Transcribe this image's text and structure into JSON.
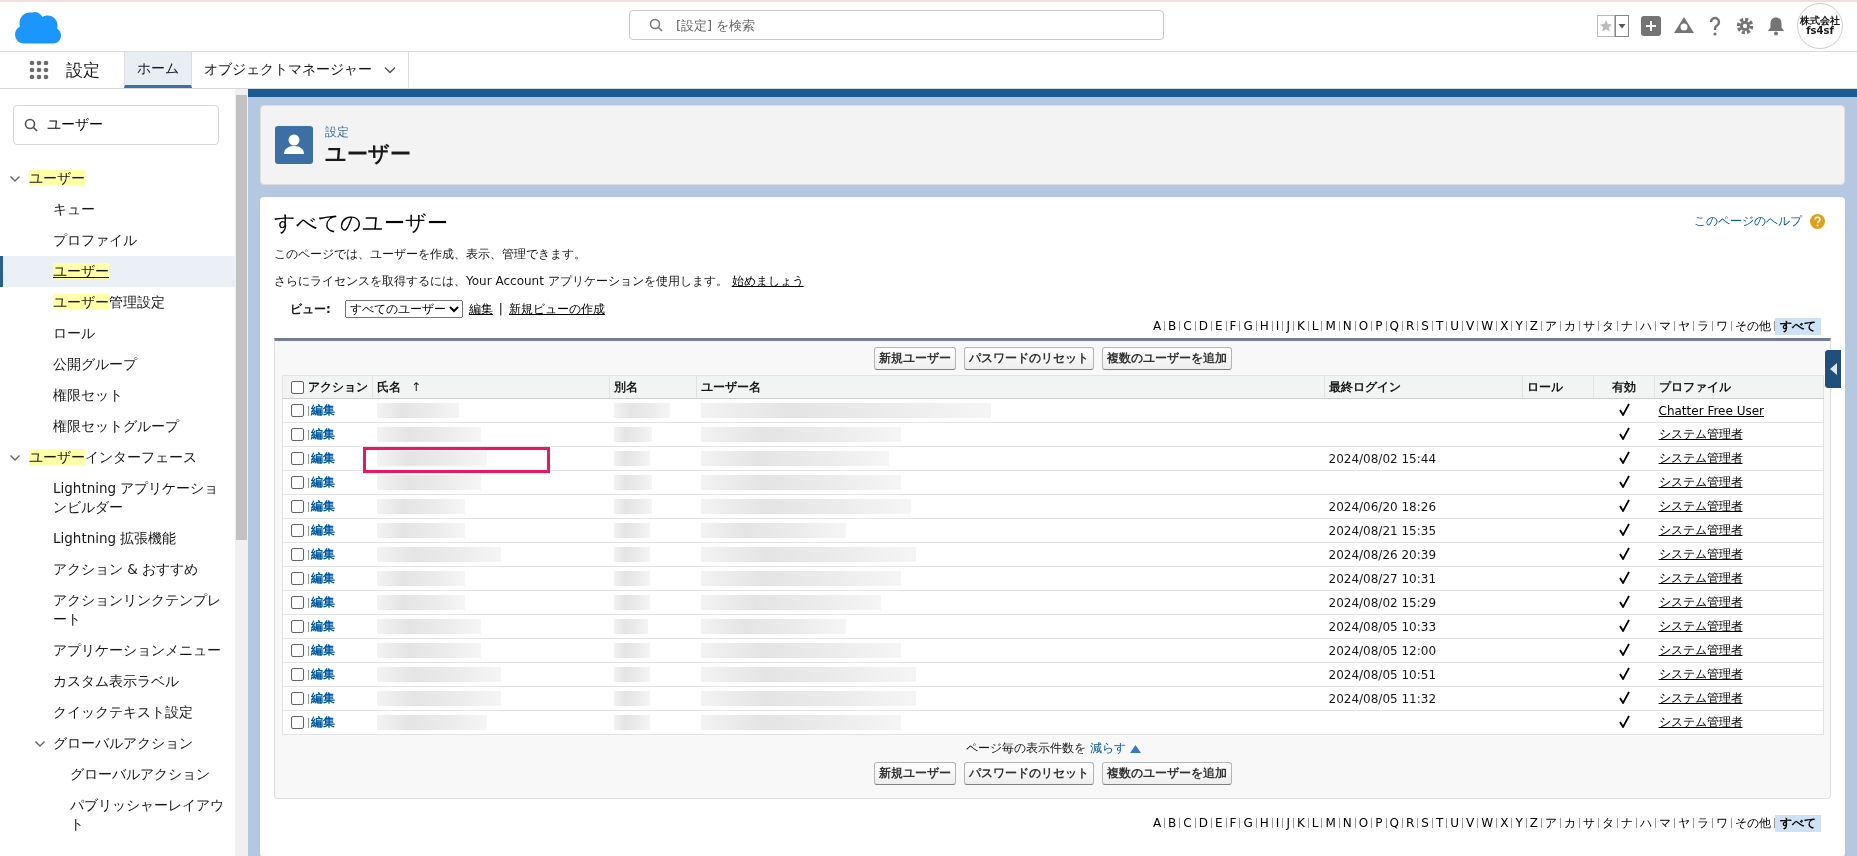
{
  "global_header": {
    "search": {
      "placeholder": "[設定] を検索"
    },
    "avatar": {
      "line1": "株式会社",
      "line2": "fs4sf"
    }
  },
  "app_nav": {
    "app_name": "設定",
    "tabs": [
      {
        "label": "ホーム",
        "selected": true,
        "dropdown": false
      },
      {
        "label": "オブジェクトマネージャー",
        "selected": false,
        "dropdown": true
      }
    ]
  },
  "sidebar": {
    "search": {
      "value": "ユーザー"
    },
    "items": [
      {
        "match": "ユーザー",
        "expanded": true,
        "selected": false,
        "children": [
          {
            "rest": "キュー",
            "selected": false
          },
          {
            "rest": "プロファイル",
            "selected": false
          },
          {
            "match": "ユーザー",
            "selected": true
          },
          {
            "match": "ユーザー",
            "rest": "管理設定",
            "selected": false
          },
          {
            "rest": "ロール",
            "selected": false
          },
          {
            "rest": "公開グループ",
            "selected": false
          },
          {
            "rest": "権限セット",
            "selected": false
          },
          {
            "rest": "権限セットグループ",
            "selected": false
          }
        ]
      },
      {
        "match": "ユーザー",
        "rest": "インターフェース",
        "expanded": true,
        "selected": false,
        "children": [
          {
            "rest": "Lightning アプリケーションビルダー",
            "selected": false
          },
          {
            "rest": "Lightning 拡張機能",
            "selected": false
          },
          {
            "rest": "アクション & おすすめ",
            "selected": false
          },
          {
            "rest": "アクションリンクテンプレート",
            "selected": false
          },
          {
            "rest": "アプリケーションメニュー",
            "selected": false
          },
          {
            "rest": "カスタム表示ラベル",
            "selected": false
          },
          {
            "rest": "クイックテキスト設定",
            "selected": false
          },
          {
            "rest": "グローバルアクション",
            "expanded": true,
            "selected": false,
            "children": [
              {
                "rest": "グローバルアクション",
                "selected": false
              },
              {
                "rest": "パブリッシャーレイアウト",
                "selected": false
              }
            ]
          }
        ]
      }
    ]
  },
  "page_header": {
    "breadcrumb": "設定",
    "title": "ユーザー"
  },
  "main": {
    "title": "すべてのユーザー",
    "help_link": "このページのヘルプ",
    "description": "このページでは、ユーザーを作成、表示、管理できます。",
    "license_text": "さらにライセンスを取得するには、Your Account アプリケーションを使用します。",
    "license_link": "始めましょう",
    "view": {
      "label": "ビュー:",
      "selected_view": "すべてのユーザー",
      "edit_link": "編集",
      "separator": "|",
      "new_view_link": "新規ビューの作成"
    },
    "alpha_top": [
      {
        "label": "A",
        "selected": false
      },
      {
        "label": "B",
        "selected": false
      },
      {
        "label": "C",
        "selected": false
      },
      {
        "label": "D",
        "selected": false
      },
      {
        "label": "E",
        "selected": false
      },
      {
        "label": "F",
        "selected": false
      },
      {
        "label": "G",
        "selected": false
      },
      {
        "label": "H",
        "selected": false
      },
      {
        "label": "I",
        "selected": false
      },
      {
        "label": "J",
        "selected": false
      },
      {
        "label": "K",
        "selected": false
      },
      {
        "label": "L",
        "selected": false
      },
      {
        "label": "M",
        "selected": false
      },
      {
        "label": "N",
        "selected": false
      },
      {
        "label": "O",
        "selected": false
      },
      {
        "label": "P",
        "selected": false
      },
      {
        "label": "Q",
        "selected": false
      },
      {
        "label": "R",
        "selected": false
      },
      {
        "label": "S",
        "selected": false
      },
      {
        "label": "T",
        "selected": false
      },
      {
        "label": "U",
        "selected": false
      },
      {
        "label": "V",
        "selected": false
      },
      {
        "label": "W",
        "selected": false
      },
      {
        "label": "X",
        "selected": false
      },
      {
        "label": "Y",
        "selected": false
      },
      {
        "label": "Z",
        "selected": false
      },
      {
        "label": "ア",
        "selected": false
      },
      {
        "label": "カ",
        "selected": false
      },
      {
        "label": "サ",
        "selected": false
      },
      {
        "label": "タ",
        "selected": false
      },
      {
        "label": "ナ",
        "selected": false
      },
      {
        "label": "ハ",
        "selected": false
      },
      {
        "label": "マ",
        "selected": false
      },
      {
        "label": "ヤ",
        "selected": false
      },
      {
        "label": "ラ",
        "selected": false
      },
      {
        "label": "ワ",
        "selected": false
      },
      {
        "label": "その他",
        "selected": false
      },
      {
        "label": "すべて",
        "selected": true
      }
    ],
    "buttons_top": [
      "新規ユーザー",
      "パスワードのリセット",
      "複数のユーザーを追加"
    ],
    "table": {
      "header_checkbox": {
        "checked": false
      },
      "columns": [
        {
          "label": "アクション"
        },
        {
          "label": "氏名",
          "sort_icon": "↑"
        },
        {
          "label": "別名"
        },
        {
          "label": "ユーザー名"
        },
        {
          "label": "最終ログイン"
        },
        {
          "label": "ロール"
        },
        {
          "label": "有効"
        },
        {
          "label": "プロファイル"
        }
      ],
      "rows": [
        {
          "checked": false,
          "action": "編集",
          "active": true,
          "profile": "Chatter Free User",
          "highlighted": false
        },
        {
          "checked": false,
          "action": "編集",
          "active": true,
          "profile": "システム管理者",
          "highlighted": false
        },
        {
          "checked": false,
          "action": "編集",
          "last_login": "2024/08/02 15:44",
          "active": true,
          "profile": "システム管理者",
          "highlighted": true
        },
        {
          "checked": false,
          "action": "編集",
          "active": true,
          "profile": "システム管理者",
          "highlighted": false
        },
        {
          "checked": false,
          "action": "編集",
          "last_login": "2024/06/20 18:26",
          "active": true,
          "profile": "システム管理者",
          "highlighted": false
        },
        {
          "checked": false,
          "action": "編集",
          "last_login": "2024/08/21 15:35",
          "active": true,
          "profile": "システム管理者",
          "highlighted": false
        },
        {
          "checked": false,
          "action": "編集",
          "last_login": "2024/08/26 20:39",
          "active": true,
          "profile": "システム管理者",
          "highlighted": false
        },
        {
          "checked": false,
          "action": "編集",
          "last_login": "2024/08/27 10:31",
          "active": true,
          "profile": "システム管理者",
          "highlighted": false
        },
        {
          "checked": false,
          "action": "編集",
          "last_login": "2024/08/02 15:29",
          "active": true,
          "profile": "システム管理者",
          "highlighted": false
        },
        {
          "checked": false,
          "action": "編集",
          "last_login": "2024/08/05 10:33",
          "active": true,
          "profile": "システム管理者",
          "highlighted": false
        },
        {
          "checked": false,
          "action": "編集",
          "last_login": "2024/08/05 12:00",
          "active": true,
          "profile": "システム管理者",
          "highlighted": false
        },
        {
          "checked": false,
          "action": "編集",
          "last_login": "2024/08/05 10:51",
          "active": true,
          "profile": "システム管理者",
          "highlighted": false
        },
        {
          "checked": false,
          "action": "編集",
          "last_login": "2024/08/05 11:32",
          "active": true,
          "profile": "システム管理者",
          "highlighted": false
        },
        {
          "checked": false,
          "action": "編集",
          "active": true,
          "profile": "システム管理者",
          "highlighted": false
        }
      ]
    },
    "page_size": {
      "text": "ページ毎の表示件数を",
      "link": "減らす"
    },
    "buttons_bottom": [
      "新規ユーザー",
      "パスワードのリセット",
      "複数のユーザーを追加"
    ],
    "alpha_bottom": [
      {
        "label": "A",
        "selected": false
      },
      {
        "label": "B",
        "selected": false
      },
      {
        "label": "C",
        "selected": false
      },
      {
        "label": "D",
        "selected": false
      },
      {
        "label": "E",
        "selected": false
      },
      {
        "label": "F",
        "selected": false
      },
      {
        "label": "G",
        "selected": false
      },
      {
        "label": "H",
        "selected": false
      },
      {
        "label": "I",
        "selected": false
      },
      {
        "label": "J",
        "selected": false
      },
      {
        "label": "K",
        "selected": false
      },
      {
        "label": "L",
        "selected": false
      },
      {
        "label": "M",
        "selected": false
      },
      {
        "label": "N",
        "selected": false
      },
      {
        "label": "O",
        "selected": false
      },
      {
        "label": "P",
        "selected": false
      },
      {
        "label": "Q",
        "selected": false
      },
      {
        "label": "R",
        "selected": false
      },
      {
        "label": "S",
        "selected": false
      },
      {
        "label": "T",
        "selected": false
      },
      {
        "label": "U",
        "selected": false
      },
      {
        "label": "V",
        "selected": false
      },
      {
        "label": "W",
        "selected": false
      },
      {
        "label": "X",
        "selected": false
      },
      {
        "label": "Y",
        "selected": false
      },
      {
        "label": "Z",
        "selected": false
      },
      {
        "label": "ア",
        "selected": false
      },
      {
        "label": "カ",
        "selected": false
      },
      {
        "label": "サ",
        "selected": false
      },
      {
        "label": "タ",
        "selected": false
      },
      {
        "label": "ナ",
        "selected": false
      },
      {
        "label": "ハ",
        "selected": false
      },
      {
        "label": "マ",
        "selected": false
      },
      {
        "label": "ヤ",
        "selected": false
      },
      {
        "label": "ラ",
        "selected": false
      },
      {
        "label": "ワ",
        "selected": false
      },
      {
        "label": "その他",
        "selected": false
      },
      {
        "label": "すべて",
        "selected": true
      }
    ]
  }
}
